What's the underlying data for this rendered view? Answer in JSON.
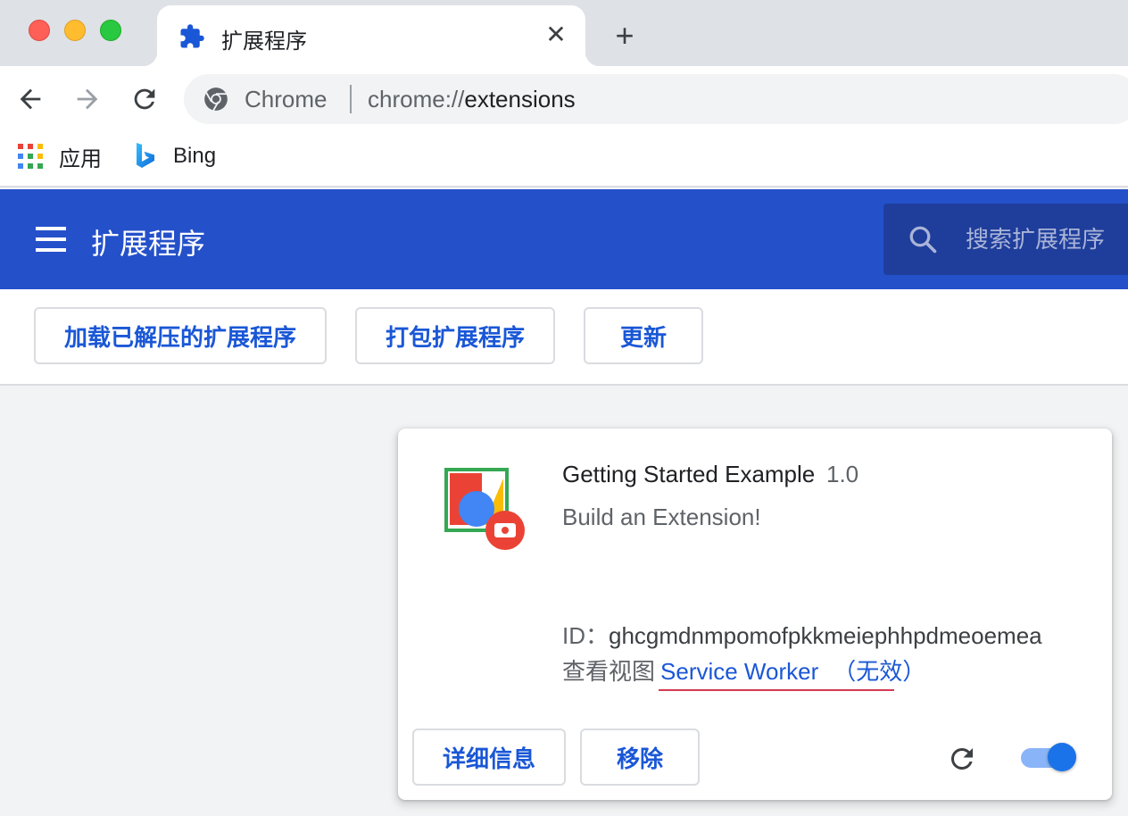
{
  "browser": {
    "tab": {
      "title": "扩展程序",
      "icon": "puzzle-icon",
      "close_glyph": "✕"
    },
    "new_tab_glyph": "+",
    "omnibox": {
      "site_label": "Chrome",
      "url_scheme": "chrome://",
      "url_path": "extensions"
    },
    "bookmarks": [
      {
        "label": "应用",
        "icon": "apps-grid-icon"
      },
      {
        "label": "Bing",
        "icon": "bing-icon"
      }
    ]
  },
  "header": {
    "title": "扩展程序",
    "search_placeholder": "搜索扩展程序",
    "accent_color": "#2450ca"
  },
  "actions": {
    "load_unpacked": "加载已解压的扩展程序",
    "pack": "打包扩展程序",
    "update": "更新"
  },
  "extension": {
    "name": "Getting Started Example",
    "version": "1.0",
    "description": "Build an Extension!",
    "id_label": "ID：",
    "id_value": "ghcgmdnmpomofpkkmeiephhpdmeoemea",
    "views_label": "查看视图",
    "service_worker_link": "Service Worker",
    "inactive_label": "（无效）",
    "details_button": "详细信息",
    "remove_button": "移除",
    "enabled": true
  }
}
